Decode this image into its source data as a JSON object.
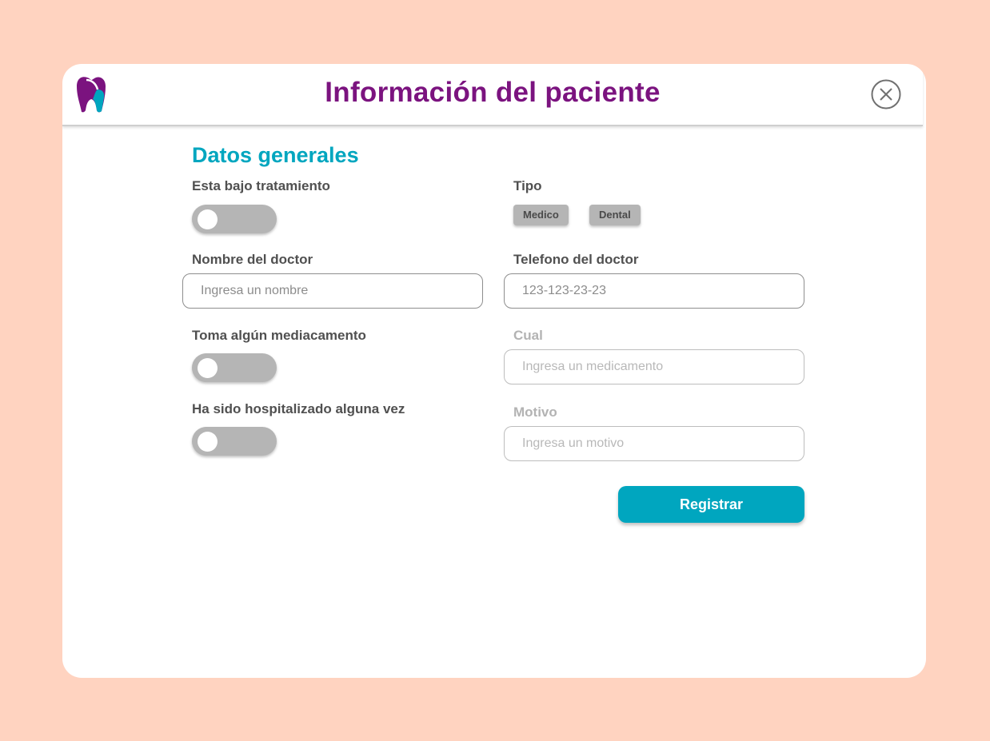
{
  "header": {
    "title": "Información del paciente",
    "logo_icon": "tooth-icon",
    "close_icon": "close-circle-icon"
  },
  "section": {
    "title": "Datos generales"
  },
  "form": {
    "under_treatment": {
      "label": "Esta bajo tratamiento",
      "on": false
    },
    "type": {
      "label": "Tipo",
      "options": [
        "Medico",
        "Dental"
      ]
    },
    "doctor_name": {
      "label": "Nombre del doctor",
      "placeholder": "Ingresa un nombre"
    },
    "doctor_phone": {
      "label": "Telefono del doctor",
      "placeholder": "123-123-23-23"
    },
    "takes_medication": {
      "label": "Toma algún mediacamento",
      "on": false
    },
    "medication_which": {
      "label": "Cual",
      "placeholder": "Ingresa un medicamento"
    },
    "hospitalized": {
      "label": "Ha sido hospitalizado alguna vez",
      "on": false
    },
    "reason": {
      "label": "Motivo",
      "placeholder": "Ingresa un motivo"
    },
    "submit_label": "Registrar"
  },
  "colors": {
    "background": "#ffd3c0",
    "title": "#7b137f",
    "accent": "#00a6bf",
    "toggle_off": "#b5b5b5"
  }
}
